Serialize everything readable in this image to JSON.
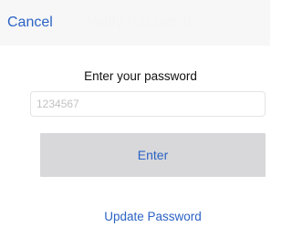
{
  "navbar": {
    "cancel_label": "Cancel",
    "title": "Verify Password"
  },
  "form": {
    "prompt": "Enter your password",
    "password_placeholder": "1234567",
    "enter_label": "Enter",
    "update_link": "Update Password"
  },
  "colors": {
    "accent": "#2b63c4",
    "navbar_bg": "#f7f7f8",
    "button_bg": "#d8d8da",
    "placeholder": "#c2c2c6"
  }
}
